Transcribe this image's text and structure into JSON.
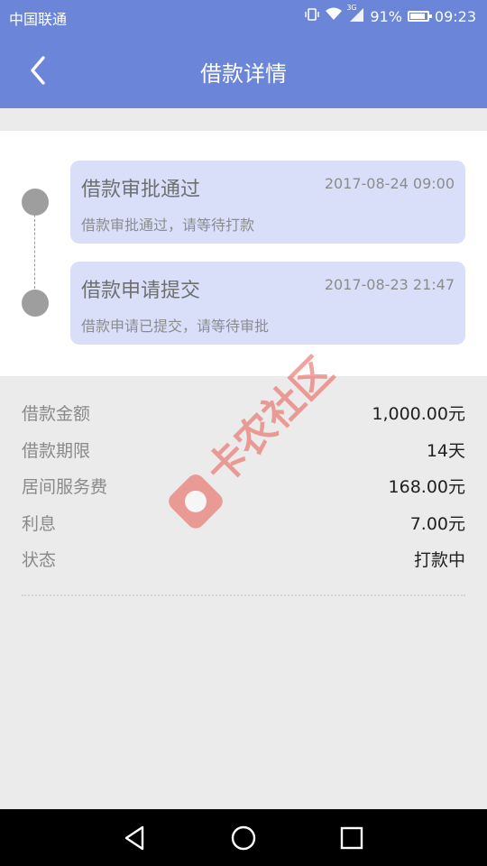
{
  "status_bar": {
    "carrier": "中国联通",
    "network": "3G",
    "battery": "91%",
    "time": "09:23"
  },
  "header": {
    "title": "借款详情"
  },
  "timeline": [
    {
      "title": "借款审批通过",
      "time": "2017-08-24 09:00",
      "desc": "借款审批通过，请等待打款"
    },
    {
      "title": "借款申请提交",
      "time": "2017-08-23 21:47",
      "desc": "借款申请已提交，请等待审批"
    }
  ],
  "details": [
    {
      "label": "借款金额",
      "value": "1,000.00元"
    },
    {
      "label": "借款期限",
      "value": "14天"
    },
    {
      "label": "居间服务费",
      "value": "168.00元"
    },
    {
      "label": "利息",
      "value": "7.00元"
    },
    {
      "label": "状态",
      "value": "打款中"
    }
  ],
  "watermark": {
    "text": "卡农社区"
  },
  "colors": {
    "primary": "#6b86d9",
    "bubble": "#d9dff8",
    "watermark": "#e8584f"
  }
}
